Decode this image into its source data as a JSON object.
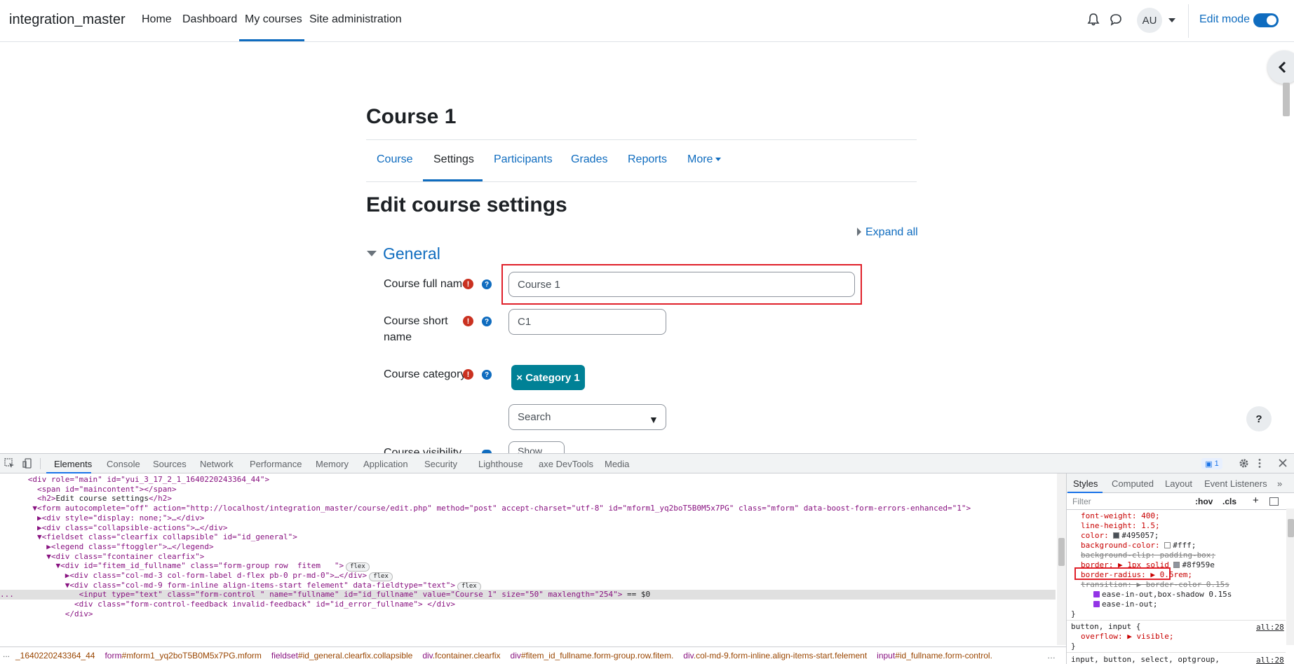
{
  "navbar": {
    "site_name": "integration_master",
    "links": [
      "Home",
      "Dashboard",
      "My courses",
      "Site administration"
    ],
    "avatar": "AU",
    "edit_mode_label": "Edit mode",
    "edit_mode_on": true,
    "icons": [
      "bell-icon",
      "message-icon",
      "chevron-down-icon",
      "chevron-left-icon"
    ]
  },
  "course": {
    "title": "Course 1",
    "tabs": [
      "Course",
      "Settings",
      "Participants",
      "Grades",
      "Reports",
      "More"
    ],
    "active_tab": "Settings"
  },
  "form": {
    "heading": "Edit course settings",
    "expand_all": "Expand all",
    "section": "General",
    "required_marker": "!",
    "help_marker": "?",
    "fields": {
      "fullname_label": "Course full name",
      "fullname_value": "Course 1",
      "shortname_label": "Course short name",
      "shortname_value": "C1",
      "category_label": "Course category",
      "category_chip": "× Category 1",
      "category_search": "Search",
      "category_caret": "▼",
      "visibility_label": "Course visibility",
      "visibility_value": "Show"
    }
  },
  "help_button": "?",
  "devtools": {
    "tabs": [
      "Elements",
      "Console",
      "Sources",
      "Network",
      "Performance",
      "Memory",
      "Application",
      "Security",
      "Lighthouse",
      "axe DevTools",
      "Media"
    ],
    "active_tab": "Elements",
    "issues_count": "1",
    "dom_lines": [
      [
        {
          "c": "t",
          "s": "      <div role=\"main\" id=\"yui_3_17_2_1_1640220243364_44\">"
        }
      ],
      [
        {
          "c": "t",
          "s": "        <span id=\"maincontent\"></span>"
        }
      ],
      [
        {
          "c": "t",
          "s": "        <h2>"
        },
        {
          "c": "x",
          "s": "Edit course settings"
        },
        {
          "c": "t",
          "s": "</h2>"
        }
      ],
      [
        {
          "c": "t",
          "s": "       ▼<form autocomplete=\"off\" action=\"http://localhost/integration_master/course/edit.php\" method=\"post\" accept-charset=\"utf-8\" id=\"mform1_yq2boT5B0M5x7PG\" class=\"mform\" data-boost-form-errors-enhanced=\"1\">"
        }
      ],
      [
        {
          "c": "t",
          "s": "        ▶<div style=\"display: none;\">…</div>"
        }
      ],
      [
        {
          "c": "t",
          "s": "        ▶<div class=\"collapsible-actions\">…</div>"
        }
      ],
      [
        {
          "c": "t",
          "s": "        ▼<fieldset class=\"clearfix collapsible\" id=\"id_general\">"
        }
      ],
      [
        {
          "c": "t",
          "s": "          ▶<legend class=\"ftoggler\">…</legend>"
        }
      ],
      [
        {
          "c": "t",
          "s": "          ▼<div class=\"fcontainer clearfix\">"
        }
      ],
      [
        {
          "c": "t",
          "s": "            ▼<div id=\"fitem_id_fullname\" class=\"form-group row  fitem   \">"
        },
        {
          "c": "flex",
          "s": "flex"
        }
      ],
      [
        {
          "c": "t",
          "s": "              ▶<div class=\"col-md-3 col-form-label d-flex pb-0 pr-md-0\">…</div>"
        },
        {
          "c": "flex",
          "s": "flex"
        }
      ],
      [
        {
          "c": "t",
          "s": "              ▼<div class=\"col-md-9 form-inline align-items-start felement\" data-fieldtype=\"text\">"
        },
        {
          "c": "flex",
          "s": "flex"
        }
      ],
      [
        {
          "c": "t",
          "s": "...              <input type=\"text\" class=\"form-control \" name=\"fullname\" id=\"id_fullname\" value=\"Course 1\" size=\"50\" maxlength=\"254\"> "
        },
        {
          "c": "x",
          "s": "== $0"
        }
      ],
      [
        {
          "c": "t",
          "s": "                <div class=\"form-control-feedback invalid-feedback\" id=\"id_error_fullname\"> </div>"
        }
      ],
      [
        {
          "c": "t",
          "s": "              </div>"
        }
      ]
    ],
    "breadcrumbs": [
      {
        "tag": "",
        "cls": "_1640220243364_44"
      },
      {
        "tag": "form",
        "cls": "#mform1_yq2boT5B0M5x7PG.mform"
      },
      {
        "tag": "fieldset",
        "cls": "#id_general.clearfix.collapsible"
      },
      {
        "tag": "div",
        "cls": ".fcontainer.clearfix"
      },
      {
        "tag": "div",
        "cls": "#fitem_id_fullname.form-group.row.fitem."
      },
      {
        "tag": "div",
        "cls": ".col-md-9.form-inline.align-items-start.felement"
      },
      {
        "tag": "input",
        "cls": "#id_fullname.form-control."
      }
    ],
    "breadcrumb_more": "…",
    "styles": {
      "tabs": [
        "Styles",
        "Computed",
        "Layout",
        "Event Listeners"
      ],
      "overflow_chevron": "»",
      "filter_placeholder": "Filter",
      "hov": ":hov",
      "cls": ".cls",
      "plus": "+",
      "props": {
        "font_weight": "font-weight: 400;",
        "line_height": "line-height: 1.5;",
        "color": "color:",
        "color_val": "#495057;",
        "bg_color": "background-color:",
        "bg_color_val": "#fff;",
        "bg_clip": "background-clip: padding-box;",
        "border": "border: ▶ 1px solid",
        "border_val": "#8f959e",
        "border_radius": "border-radius: ▶ 0.5rem;",
        "transition": "transition: ▶ border-color 0.15s",
        "trans_sub1": "ease-in-out,box-shadow 0.15s",
        "trans_sub2": "ease-in-out;",
        "close": "}",
        "rule2_sel": "button, input {",
        "rule2_prop": "overflow: ▶ visible;",
        "rule2_close": "}",
        "rule3_sel": "input, button, select, optgroup,",
        "src": "all:28",
        "src2": "all:28"
      }
    },
    "colors": {
      "swatch_color": "#495057",
      "swatch_bg": "#ffffff",
      "swatch_border": "#8f959e"
    }
  }
}
